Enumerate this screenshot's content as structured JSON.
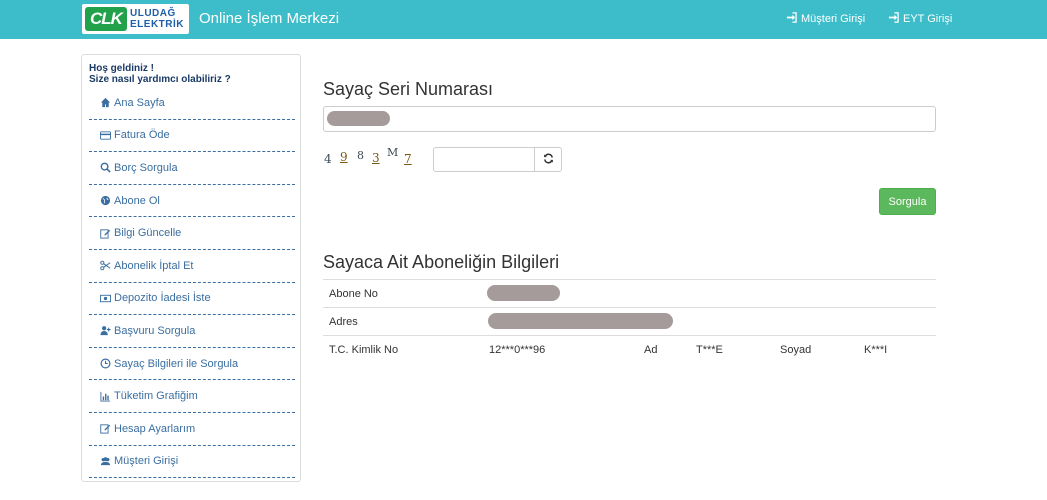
{
  "header": {
    "logo_badge": "CLK",
    "logo_line1": "ULUDAĞ",
    "logo_line2": "ELEKTRİK",
    "title": "Online İşlem Merkezi",
    "nav": [
      {
        "label": "Müşteri Girişi",
        "icon": "sign-in-icon"
      },
      {
        "label": "EYT Girişi",
        "icon": "sign-in-icon"
      }
    ]
  },
  "sidebar": {
    "welcome_line1": "Hoş geldiniz !",
    "welcome_line2": "Size nasıl yardımcı olabiliriz ?",
    "items": [
      {
        "label": "Ana Sayfa",
        "icon": "home-icon"
      },
      {
        "label": "Fatura Öde",
        "icon": "credit-card-icon"
      },
      {
        "label": "Borç Sorgula",
        "icon": "search-icon"
      },
      {
        "label": "Abone Ol",
        "icon": "globe-icon"
      },
      {
        "label": "Bilgi Güncelle",
        "icon": "edit-icon"
      },
      {
        "label": "Abonelik İptal Et",
        "icon": "scissors-icon"
      },
      {
        "label": "Depozito İadesi İste",
        "icon": "money-icon"
      },
      {
        "label": "Başvuru Sorgula",
        "icon": "user-plus-icon"
      },
      {
        "label": "Sayaç Bilgileri ile Sorgula",
        "icon": "clock-icon"
      },
      {
        "label": "Tüketim Grafiğim",
        "icon": "bar-chart-icon"
      },
      {
        "label": "Hesap Ayarlarım",
        "icon": "edit-icon"
      },
      {
        "label": "Müşteri Girişi",
        "icon": "users-icon"
      }
    ]
  },
  "main": {
    "serial_title": "Sayaç Seri Numarası",
    "captcha_chars": [
      "4",
      "9",
      "8",
      "3",
      "M",
      "7"
    ],
    "submit_label": "Sorgula",
    "info_title": "Sayaca Ait Aboneliğin Bilgileri",
    "rows": {
      "subscriber_no_label": "Abone No",
      "address_label": "Adres",
      "tc_label": "T.C. Kimlik No",
      "tc_value": "12***0***96",
      "name_label": "Ad",
      "name_value": "T***E",
      "surname_label": "Soyad",
      "surname_value": "K***I"
    }
  },
  "colors": {
    "topbar": "#3dbdc9",
    "link": "#3a6ea0",
    "button": "#5cb85c",
    "redaction": "#a69b9b"
  }
}
